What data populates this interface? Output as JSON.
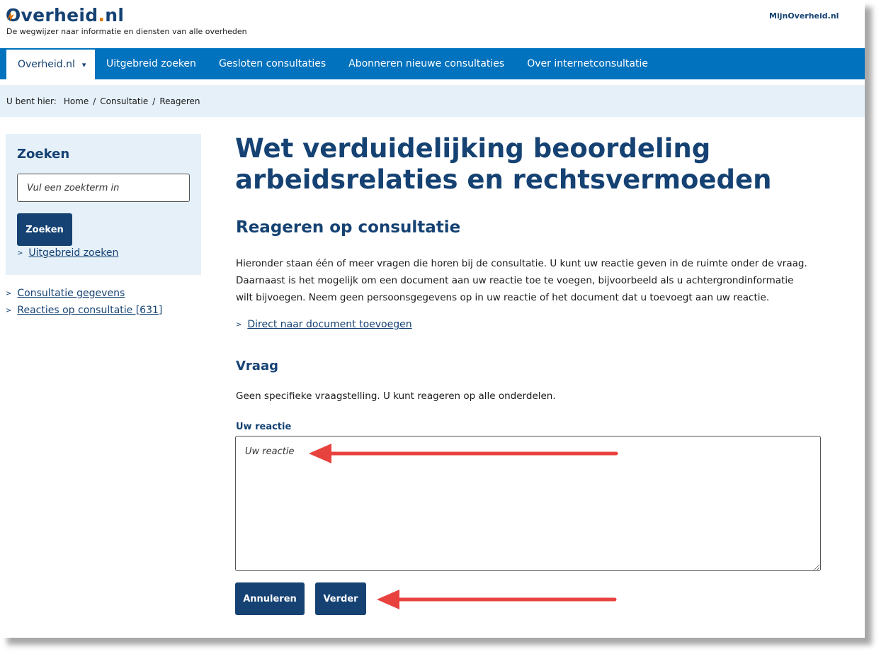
{
  "header": {
    "logo_text_main": "Overheid",
    "logo_text_dot": ".",
    "logo_text_tld": "nl",
    "tagline": "De wegwijzer naar informatie en diensten van alle overheden",
    "mijn_link": "MijnOverheid.nl"
  },
  "nav": {
    "items": [
      {
        "label": "Overheid.nl"
      },
      {
        "label": "Uitgebreid zoeken"
      },
      {
        "label": "Gesloten consultaties"
      },
      {
        "label": "Abonneren nieuwe consultaties"
      },
      {
        "label": "Over internetconsultatie"
      }
    ]
  },
  "breadcrumb": {
    "prefix": "U bent hier:",
    "items": [
      "Home",
      "Consultatie",
      "Reageren"
    ],
    "separator": "/"
  },
  "sidebar": {
    "search_title": "Zoeken",
    "search_placeholder": "Vul een zoekterm in",
    "search_button": "Zoeken",
    "advanced_link": "Uitgebreid zoeken",
    "links": [
      "Consultatie gegevens",
      "Reacties op consultatie [631]"
    ]
  },
  "main": {
    "title": "Wet verduidelijking beoordeling arbeidsrelaties en rechtsvermoeden",
    "subtitle": "Reageren op consultatie",
    "intro": "Hieronder staan één of meer vragen die horen bij de consultatie. U kunt uw reactie geven in de ruimte onder de vraag. Daarnaast is het mogelijk om een document aan uw reactie toe te voegen, bijvoorbeeld als u achtergrondinformatie wilt bijvoegen. Neem geen persoonsgegevens op in uw reactie of het document dat u toevoegt aan uw reactie.",
    "direct_link": "Direct naar document toevoegen",
    "question_heading": "Vraag",
    "question_text": "Geen specifieke vraagstelling. U kunt reageren op alle onderdelen.",
    "reaction_label": "Uw reactie",
    "reaction_placeholder": "Uw reactie",
    "cancel_button": "Annuleren",
    "next_button": "Verder"
  },
  "colors": {
    "brand_dark": "#154273",
    "nav_blue": "#0072be",
    "light_blue": "#e5f0f9",
    "annotation_red": "#e8423f"
  }
}
